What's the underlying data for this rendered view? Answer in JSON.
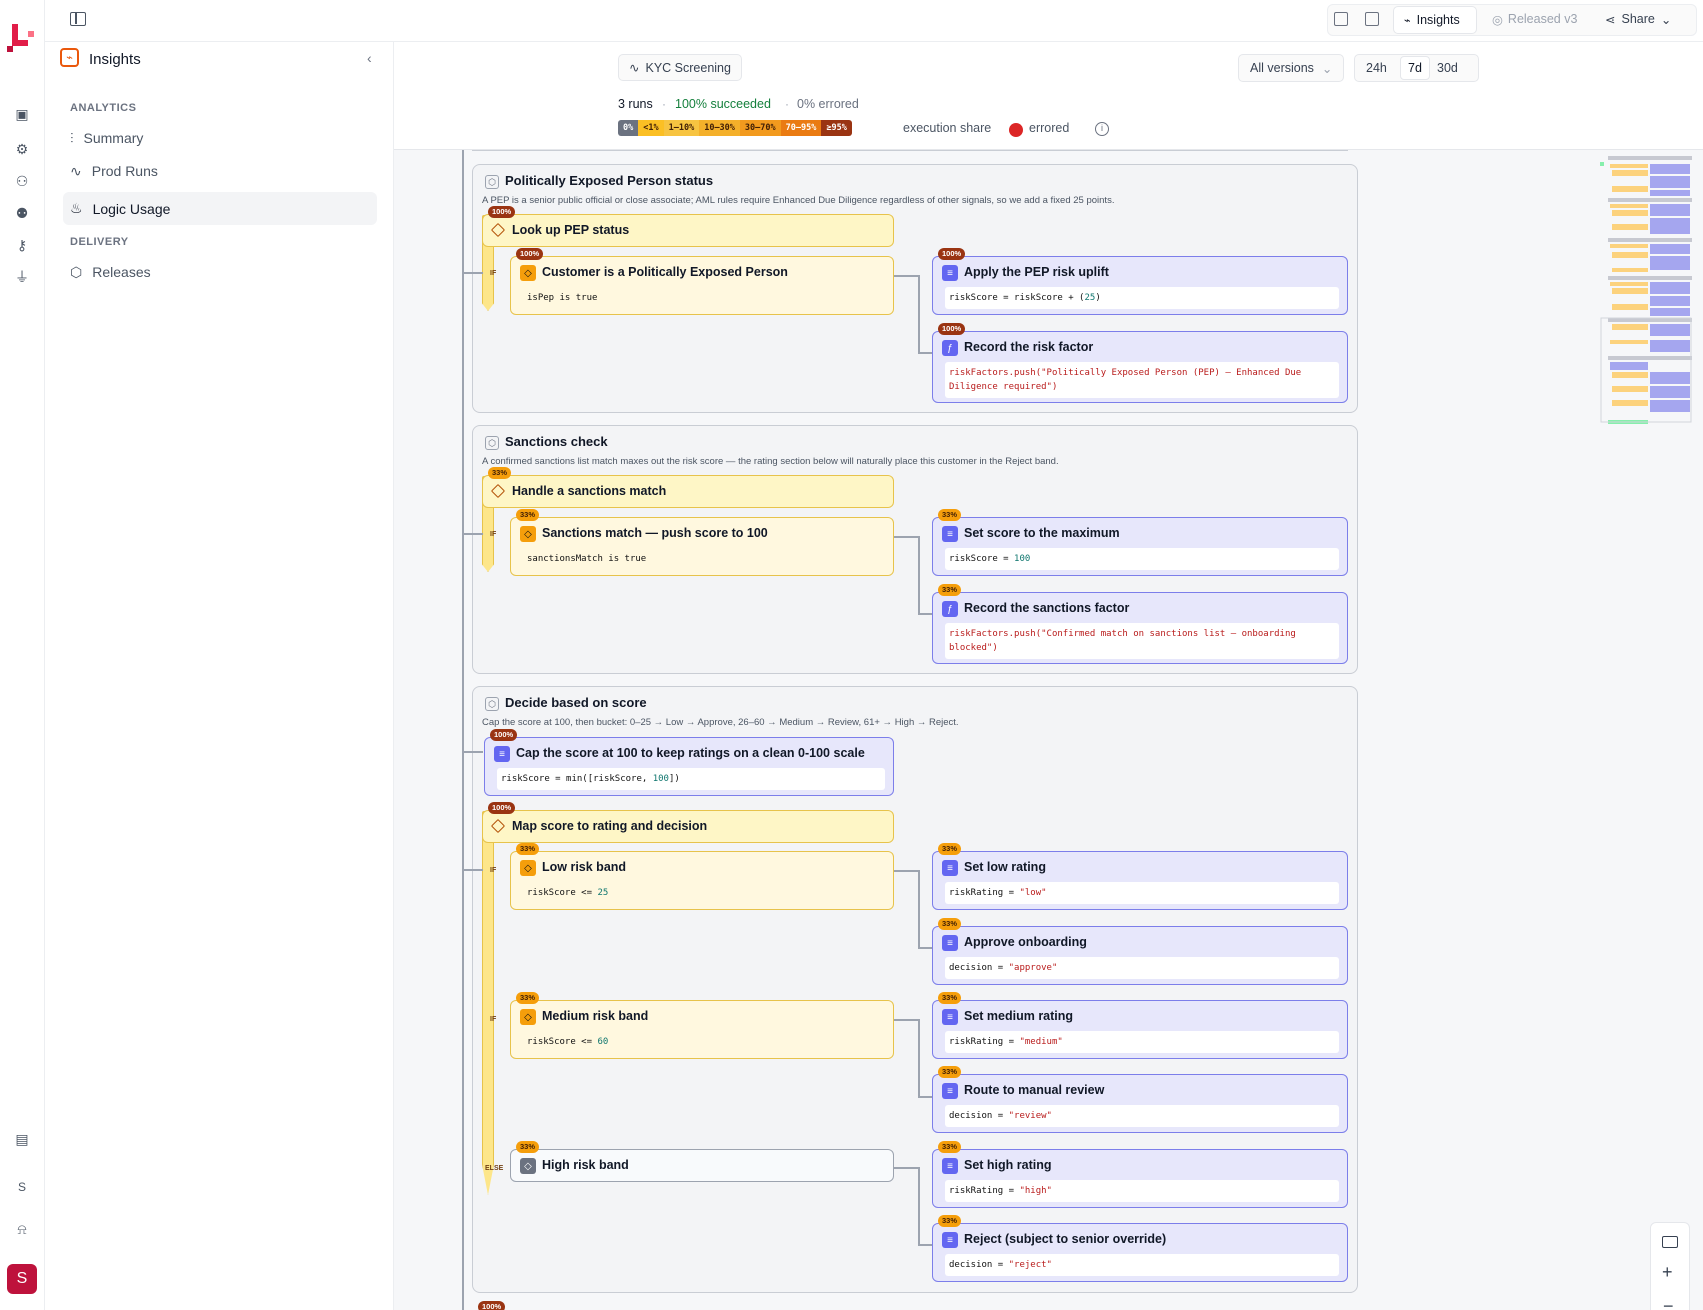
{
  "app": {
    "avatar_letter": "S",
    "user_letter": "S"
  },
  "topbar": {
    "insights": "Insights",
    "released": "Released v3",
    "share": "Share"
  },
  "sidebar": {
    "title": "Insights",
    "analytics_label": "ANALYTICS",
    "delivery_label": "DELIVERY",
    "items": [
      {
        "label": "Summary"
      },
      {
        "label": "Prod Runs"
      },
      {
        "label": "Logic Usage"
      },
      {
        "label": "Releases"
      }
    ]
  },
  "header": {
    "flow": "KYC Screening",
    "versions": "All versions",
    "ranges": [
      "24h",
      "7d",
      "30d"
    ],
    "runs": "3 runs",
    "succeeded": "100% succeeded",
    "errored": "0% errored",
    "legend": [
      "0%",
      "<1%",
      "1–10%",
      "10–30%",
      "30–70%",
      "70–95%",
      "≥95%"
    ],
    "legend_colors": [
      "#6b7280",
      "#fbbf24",
      "#f7c441",
      "#f4b02a",
      "#f29a1e",
      "#ea7b12",
      "#9a3412"
    ],
    "share_label": "execution share",
    "errored_label": "errored"
  },
  "sections": [
    {
      "title": "Politically Exposed Person status",
      "desc": "A PEP is a senior public official or close associate; AML rules require Enhanced Due Diligence regardless of other signals, so we add a fixed 25 points.",
      "head": "Look up PEP status",
      "head_pct": "100%",
      "cond": "Customer is a Politically Exposed Person",
      "cond_pct": "100%",
      "cond_code": "isPep is true",
      "a1": "Apply the PEP risk uplift",
      "a1_pct": "100%",
      "a1_code": "riskScore = riskScore + (25)",
      "a2": "Record the risk factor",
      "a2_pct": "100%",
      "a2_code1": "riskFactors.push(\"Politically Exposed Person (PEP) — Enhanced Due",
      "a2_code2": "Diligence required\")"
    },
    {
      "title": "Sanctions check",
      "desc": "A confirmed sanctions list match maxes out the risk score — the rating section below will naturally place this customer in the Reject band.",
      "head": "Handle a sanctions match",
      "head_pct": "33%",
      "cond": "Sanctions match — push score to 100",
      "cond_pct": "33%",
      "cond_code": "sanctionsMatch is true",
      "a1": "Set score to the maximum",
      "a1_pct": "33%",
      "a1_code": "riskScore = 100",
      "a2": "Record the sanctions factor",
      "a2_pct": "33%",
      "a2_code1": "riskFactors.push(\"Confirmed match on sanctions list — onboarding",
      "a2_code2": "blocked\")"
    },
    {
      "title": "Decide based on score",
      "desc": "Cap the score at 100, then bucket: 0–25 → Low → Approve, 26–60 → Medium → Review, 61+ → High → Reject.",
      "cap": "Cap the score at 100 to keep ratings on a clean 0-100 scale",
      "cap_pct": "100%",
      "cap_code": "riskScore = min([riskScore, 100])",
      "head": "Map score to rating and decision",
      "head_pct": "100%",
      "b1": "Low risk band",
      "b1_pct": "33%",
      "b1_code": "riskScore <= 25",
      "b1a1": "Set low rating",
      "b1a1_code": "riskRating = \"low\"",
      "b1a2": "Approve onboarding",
      "b1a2_code": "decision = \"approve\"",
      "b2": "Medium risk band",
      "b2_pct": "33%",
      "b2_code": "riskScore <= 60",
      "b2a1": "Set medium rating",
      "b2a1_code": "riskRating = \"medium\"",
      "b2a2": "Route to manual review",
      "b2a2_code": "decision = \"review\"",
      "b3": "High risk band",
      "b3_pct": "33%",
      "b3a1": "Set high rating",
      "b3a1_code": "riskRating = \"high\"",
      "b3a2": "Reject (subject to senior override)",
      "b3a2_code": "decision = \"reject\"",
      "act_pct": "33%",
      "if_label": "IF",
      "else_label": "ELSE"
    }
  ],
  "bottom_pct": "100%"
}
